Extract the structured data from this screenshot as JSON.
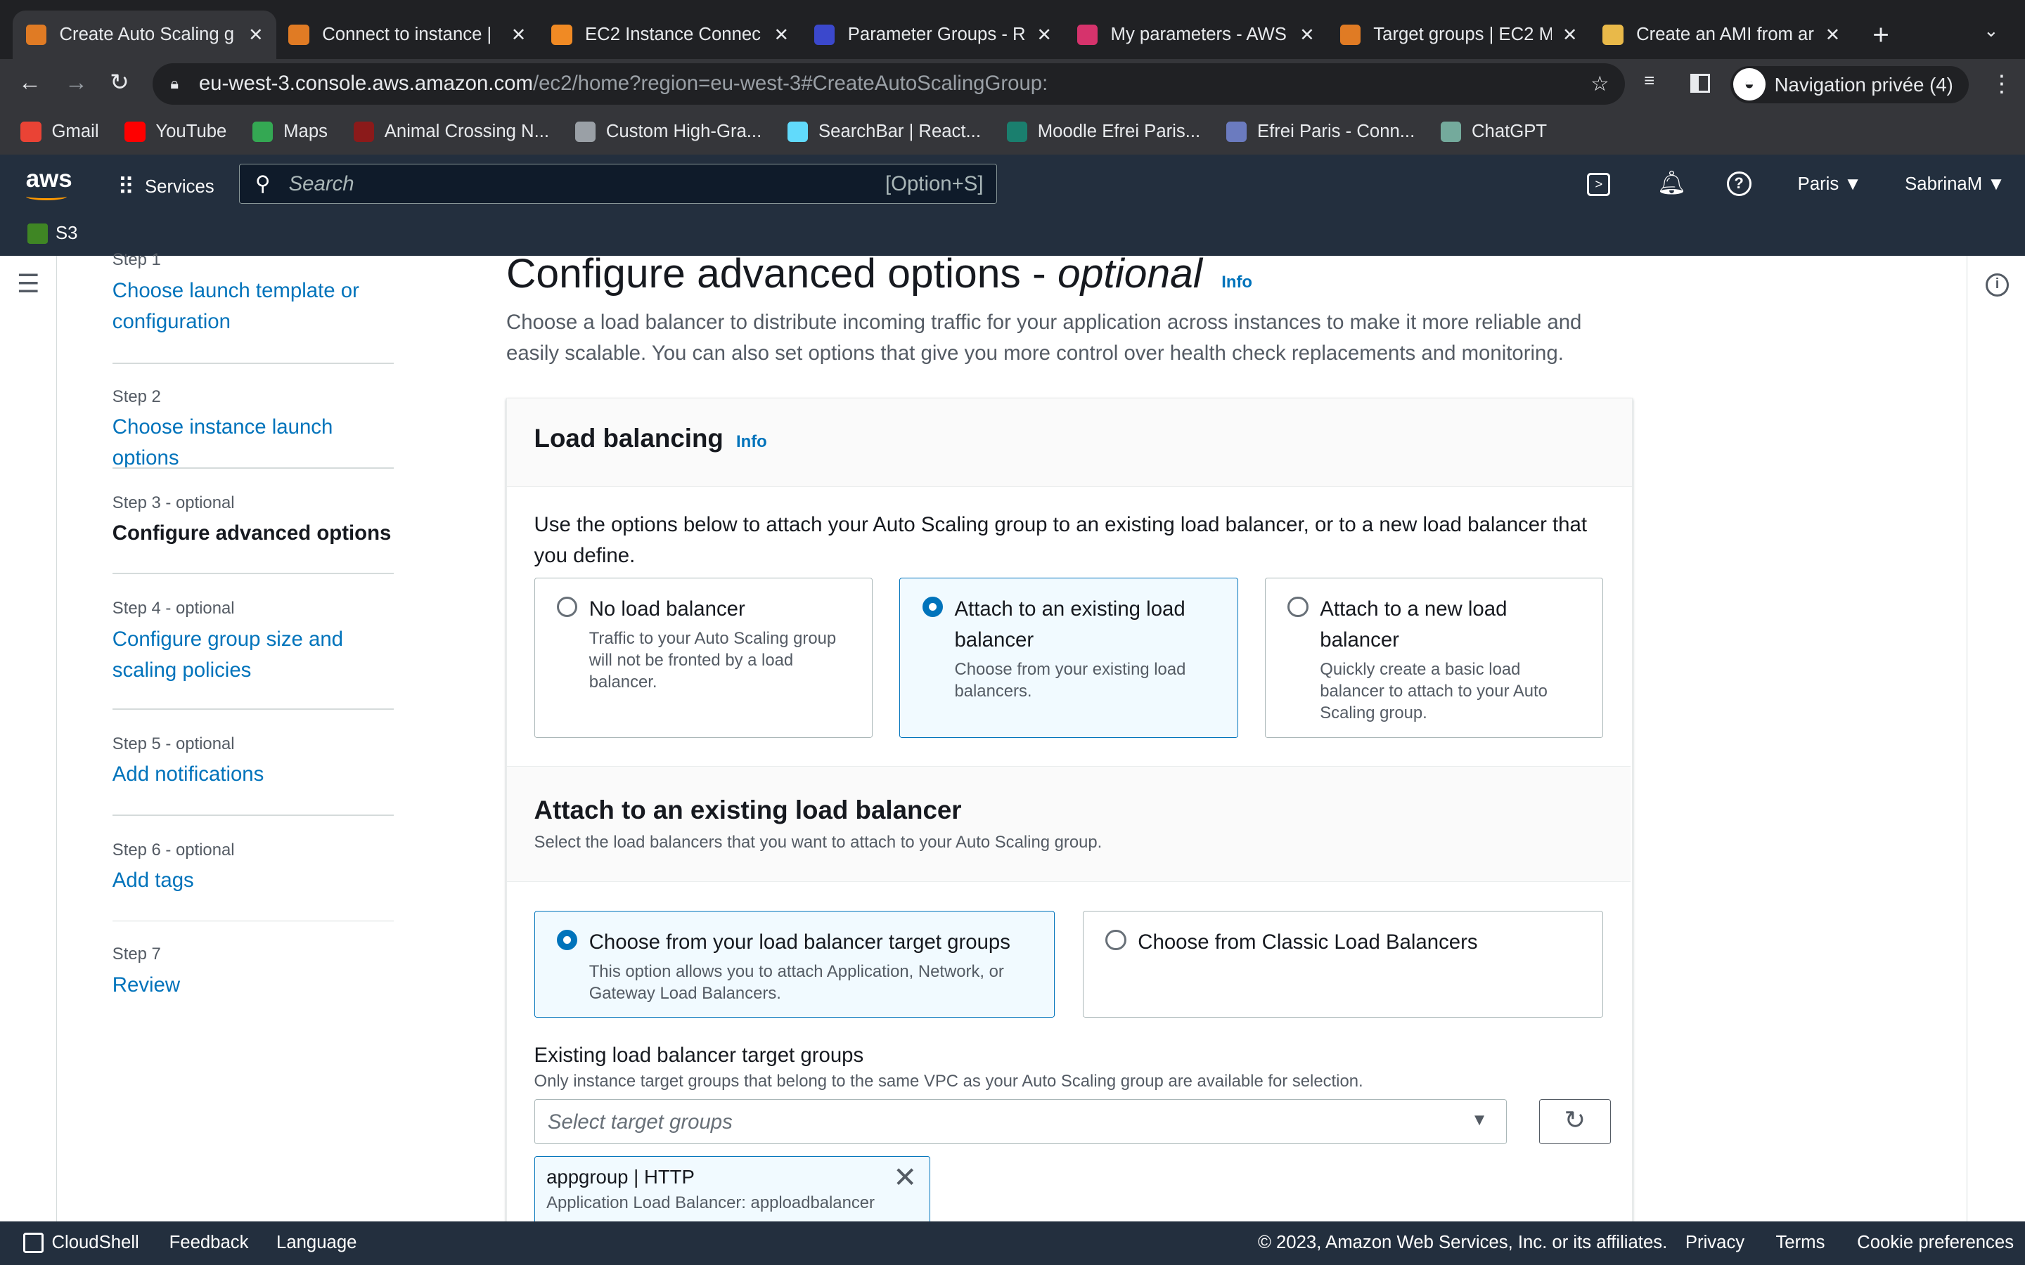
{
  "browser": {
    "tabs": [
      {
        "title": "Create Auto Scaling g",
        "color": "#e07b24",
        "active": true
      },
      {
        "title": "Connect to instance |",
        "color": "#e07b24"
      },
      {
        "title": "EC2 Instance Connec",
        "color": "#f08a24"
      },
      {
        "title": "Parameter Groups - R",
        "color": "#3b48cc"
      },
      {
        "title": "My parameters - AWS",
        "color": "#d6336c"
      },
      {
        "title": "Target groups | EC2 M",
        "color": "#e07b24"
      },
      {
        "title": "Create an AMI from ar",
        "color": "#e9b949"
      }
    ],
    "url_host": "eu-west-3.console.aws.amazon.com",
    "url_path": "/ec2/home?region=eu-west-3#CreateAutoScalingGroup:",
    "profile": "Navigation privée (4)",
    "bookmarks": [
      {
        "label": "Gmail",
        "color": "#ea4335"
      },
      {
        "label": "YouTube",
        "color": "#ff0000"
      },
      {
        "label": "Maps",
        "color": "#34a853"
      },
      {
        "label": "Animal Crossing N...",
        "color": "#8b1a1a"
      },
      {
        "label": "Custom High-Gra...",
        "color": "#9aa0a6"
      },
      {
        "label": "SearchBar | React...",
        "color": "#61dafb"
      },
      {
        "label": "Moodle Efrei Paris...",
        "color": "#1a7f6e"
      },
      {
        "label": "Efrei Paris - Conn...",
        "color": "#6b7bbf"
      },
      {
        "label": "ChatGPT",
        "color": "#74aa9c"
      }
    ]
  },
  "aws": {
    "logo": "aws",
    "services": "Services",
    "search_placeholder": "Search",
    "search_shortcut": "[Option+S]",
    "region": "Paris",
    "user": "SabrinaM",
    "favorite": "S3"
  },
  "steps": [
    {
      "num": "Step 1",
      "label": "Choose launch template or configuration"
    },
    {
      "num": "Step 2",
      "label": "Choose instance launch options"
    },
    {
      "num": "Step 3 - optional",
      "label": "Configure advanced options",
      "current": true
    },
    {
      "num": "Step 4 - optional",
      "label": "Configure group size and scaling policies"
    },
    {
      "num": "Step 5 - optional",
      "label": "Add notifications"
    },
    {
      "num": "Step 6 - optional",
      "label": "Add tags"
    },
    {
      "num": "Step 7",
      "label": "Review"
    }
  ],
  "page": {
    "title": "Configure advanced options - ",
    "title_em": "optional",
    "info": "Info",
    "desc": "Choose a load balancer to distribute incoming traffic for your application across instances to make it more reliable and easily scalable. You can also set options that give you more control over health check replacements and monitoring."
  },
  "lb": {
    "title": "Load balancing",
    "info": "Info",
    "desc": "Use the options below to attach your Auto Scaling group to an existing load balancer, or to a new load balancer that you define.",
    "options": [
      {
        "title": "No load balancer",
        "desc": "Traffic to your Auto Scaling group will not be fronted by a load balancer."
      },
      {
        "title": "Attach to an existing load balancer",
        "desc": "Choose from your existing load balancers.",
        "selected": true
      },
      {
        "title": "Attach to a new load balancer",
        "desc": "Quickly create a basic load balancer to attach to your Auto Scaling group."
      }
    ]
  },
  "existing": {
    "title": "Attach to an existing load balancer",
    "desc": "Select the load balancers that you want to attach to your Auto Scaling group.",
    "options": [
      {
        "title": "Choose from your load balancer target groups",
        "desc": "This option allows you to attach Application, Network, or Gateway Load Balancers.",
        "selected": true
      },
      {
        "title": "Choose from Classic Load Balancers",
        "desc": ""
      }
    ],
    "tg_label": "Existing load balancer target groups",
    "tg_hint": "Only instance target groups that belong to the same VPC as your Auto Scaling group are available for selection.",
    "tg_placeholder": "Select target groups",
    "token_title": "appgroup | HTTP",
    "token_sub": "Application Load Balancer: apploadbalancer"
  },
  "footer": {
    "cloudshell": "CloudShell",
    "feedback": "Feedback",
    "language": "Language",
    "copyright": "© 2023, Amazon Web Services, Inc. or its affiliates.",
    "privacy": "Privacy",
    "terms": "Terms",
    "cookies": "Cookie preferences"
  }
}
